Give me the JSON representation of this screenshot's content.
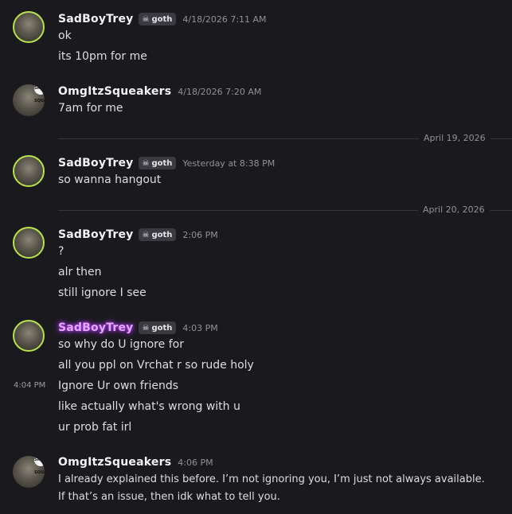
{
  "messages": [
    {
      "user": "SadBoyTrey",
      "tag": "goth",
      "time": "4/18/2026 7:11 AM",
      "lines": [
        "ok",
        "its 10pm for me"
      ]
    },
    {
      "user": "OmgItzSqueakers",
      "time": "4/18/2026 7:20 AM",
      "lines": [
        "7am for me"
      ]
    },
    {
      "user": "SadBoyTrey",
      "tag": "goth",
      "time": "Yesterday at 8:38 PM",
      "lines": [
        "so wanna hangout"
      ]
    },
    {
      "user": "SadBoyTrey",
      "tag": "goth",
      "time": "2:06 PM",
      "lines": [
        "?",
        "alr then",
        "still ignore I see"
      ]
    },
    {
      "user": "SadBoyTrey",
      "tag": "goth",
      "time": "4:03 PM",
      "hover_time": "4:04 PM",
      "lines": [
        "so why do U ignore for",
        "all you ppl on Vrchat r so rude holy",
        "Ignore Ur own friends",
        "like actually what's wrong with u",
        "ur prob fat irl"
      ]
    },
    {
      "user": "OmgItzSqueakers",
      "time": "4:06 PM",
      "lines": [
        "I already explained this before. I’m not ignoring you, I’m just not always available.",
        "If that’s an issue, then idk what to tell you."
      ]
    }
  ],
  "dividers": [
    "April 19, 2026",
    "April 20, 2026"
  ],
  "avatar_badge_text": "SKULL SQUAD",
  "icons": {
    "tag_icon": "skull-icon",
    "avatar_decoration": "sparkle-icon"
  },
  "colors": {
    "background": "#1a1a1e",
    "name_glow": "#b23cff",
    "avatar_ring": "#b8e34a"
  }
}
